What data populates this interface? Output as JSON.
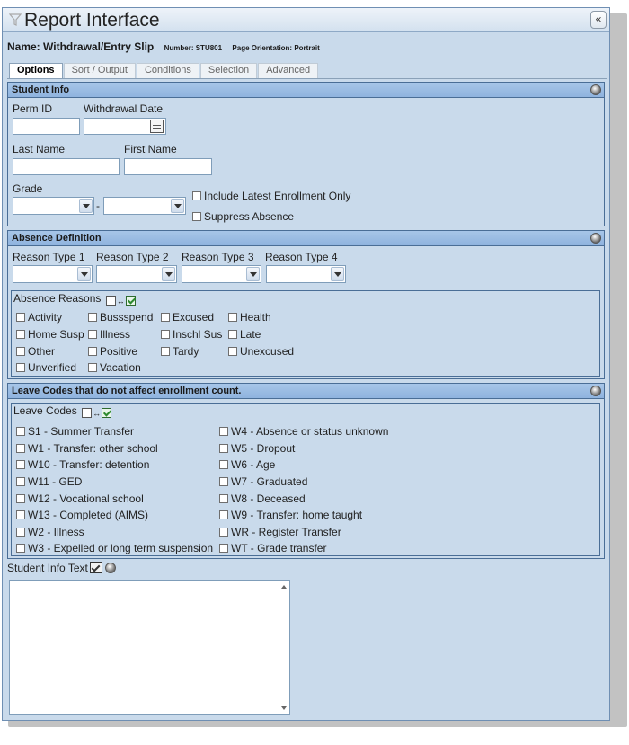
{
  "window": {
    "title": "Report Interface",
    "collapse_glyph": "«"
  },
  "report": {
    "name_label": "Name: Withdrawal/Entry Slip",
    "number_text": "Number: STU801",
    "orientation_text": "Page Orientation: Portrait"
  },
  "tabs": [
    "Options",
    "Sort / Output",
    "Conditions",
    "Selection",
    "Advanced"
  ],
  "student_info": {
    "header": "Student Info",
    "perm_id_label": "Perm ID",
    "withdrawal_date_label": "Withdrawal Date",
    "last_name_label": "Last Name",
    "first_name_label": "First Name",
    "grade_label": "Grade",
    "grade_separator": "-",
    "include_latest_label": "Include Latest Enrollment Only",
    "suppress_absence_label": "Suppress Absence"
  },
  "absence_definition": {
    "header": "Absence Definition",
    "reason_type_labels": [
      "Reason Type 1",
      "Reason Type 2",
      "Reason Type 3",
      "Reason Type 4"
    ],
    "reasons_legend": "Absence Reasons",
    "reasons": [
      "Activity",
      "Bussspend",
      "Excused",
      "Health",
      "Home Susp",
      "Illness",
      "Inschl Sus",
      "Late",
      "Other",
      "Positive",
      "Tardy",
      "Unexcused",
      "Unverified",
      "Vacation"
    ]
  },
  "leave_codes": {
    "header": "Leave Codes that do not affect enrollment count.",
    "legend": "Leave Codes",
    "left": [
      "S1 - Summer Transfer",
      "W1 - Transfer: other school",
      "W10 - Transfer: detention",
      "W11 - GED",
      "W12 - Vocational school",
      "W13 - Completed (AIMS)",
      "W2 - Illness",
      "W3 - Expelled or long term suspension"
    ],
    "right": [
      "W4 - Absence or status unknown",
      "W5 - Dropout",
      "W6 - Age",
      "W7 - Graduated",
      "W8 - Deceased",
      "W9 - Transfer: home taught",
      "WR - Register Transfer",
      "WT - Grade transfer"
    ]
  },
  "student_info_text": {
    "label": "Student Info Text",
    "value": ""
  }
}
